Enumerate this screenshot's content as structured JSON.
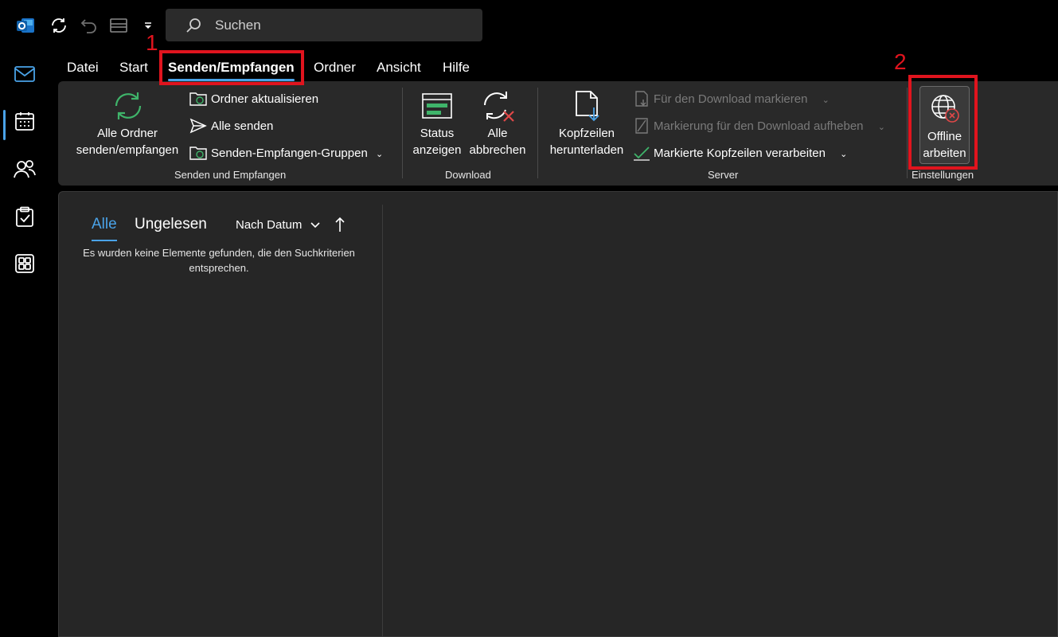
{
  "search": {
    "placeholder": "Suchen"
  },
  "menu": {
    "tabs": [
      "Datei",
      "Start",
      "Senden/Empfangen",
      "Ordner",
      "Ansicht",
      "Hilfe"
    ],
    "active_index": 2
  },
  "ribbon": {
    "send_receive_group": {
      "label": "Senden und Empfangen",
      "all_folders": [
        "Alle Ordner",
        "senden/empfangen"
      ],
      "update_folder": "Ordner aktualisieren",
      "send_all": "Alle senden",
      "groups": "Senden-Empfangen-Gruppen"
    },
    "download_group": {
      "label": "Download",
      "status": [
        "Status",
        "anzeigen"
      ],
      "cancel_all": [
        "Alle",
        "abbrechen"
      ]
    },
    "server_group": {
      "label": "Server",
      "download_headers": [
        "Kopfzeilen",
        "herunterladen"
      ],
      "mark_download": "Für den Download markieren",
      "unmark_download": "Markierung für den Download aufheben",
      "process_marked": "Markierte Kopfzeilen verarbeiten"
    },
    "settings_group": {
      "label": "Einstellungen",
      "work_offline": [
        "Offline",
        "arbeiten"
      ]
    }
  },
  "annotations": {
    "one": "1",
    "two": "2"
  },
  "list": {
    "tab_all": "Alle",
    "tab_unread": "Ungelesen",
    "sort_label": "Nach Datum",
    "empty_message": "Es wurden keine Elemente gefunden, die den Suchkriterien entsprechen."
  },
  "colors": {
    "accent": "#4aa3e8",
    "annotation_red": "#e0141e",
    "sync_green": "#3fb46a",
    "cancel_red": "#e04848"
  }
}
